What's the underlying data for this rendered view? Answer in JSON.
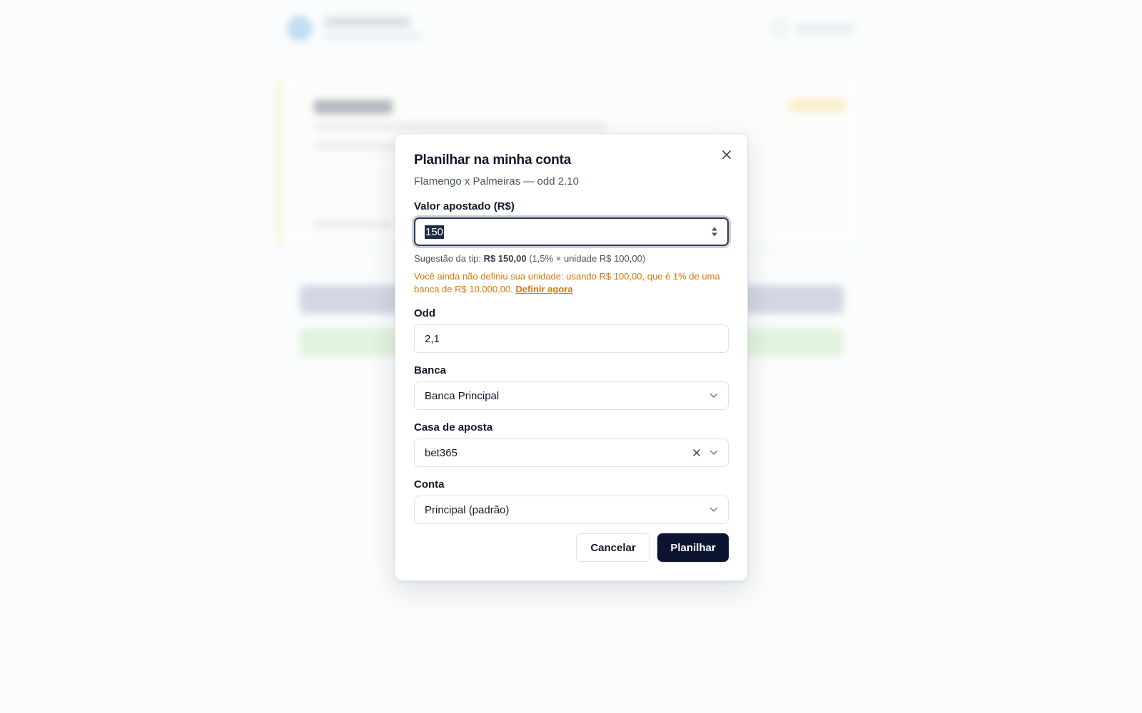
{
  "modal": {
    "title": "Planilhar na minha conta",
    "subtitle": "Flamengo x Palmeiras — odd 2.10"
  },
  "fields": {
    "valor": {
      "label": "Valor apostado (R$)",
      "value": "150"
    },
    "hint": {
      "prefix": "Sugestão da tip: ",
      "amount": "R$ 150,00",
      "suffix": " (1,5% × unidade R$ 100,00)"
    },
    "warning": {
      "text": "Você ainda não definiu sua unidade: usando R$ 100,00, que é 1% de uma banca de R$ 10.000,00. ",
      "link": "Definir agora"
    },
    "odd": {
      "label": "Odd",
      "value": "2,1"
    },
    "banca": {
      "label": "Banca",
      "value": "Banca Principal"
    },
    "casa": {
      "label": "Casa de aposta",
      "value": "bet365"
    },
    "conta": {
      "label": "Conta",
      "value": "Principal (padrão)"
    }
  },
  "buttons": {
    "cancel": "Cancelar",
    "submit": "Planilhar"
  },
  "icons": {
    "close": "close-icon",
    "chevron": "chevron-down-icon",
    "clear": "clear-icon"
  },
  "colors": {
    "primary": "#0b1532",
    "warning": "#d97706",
    "focus_ring": "#2e3a55"
  }
}
